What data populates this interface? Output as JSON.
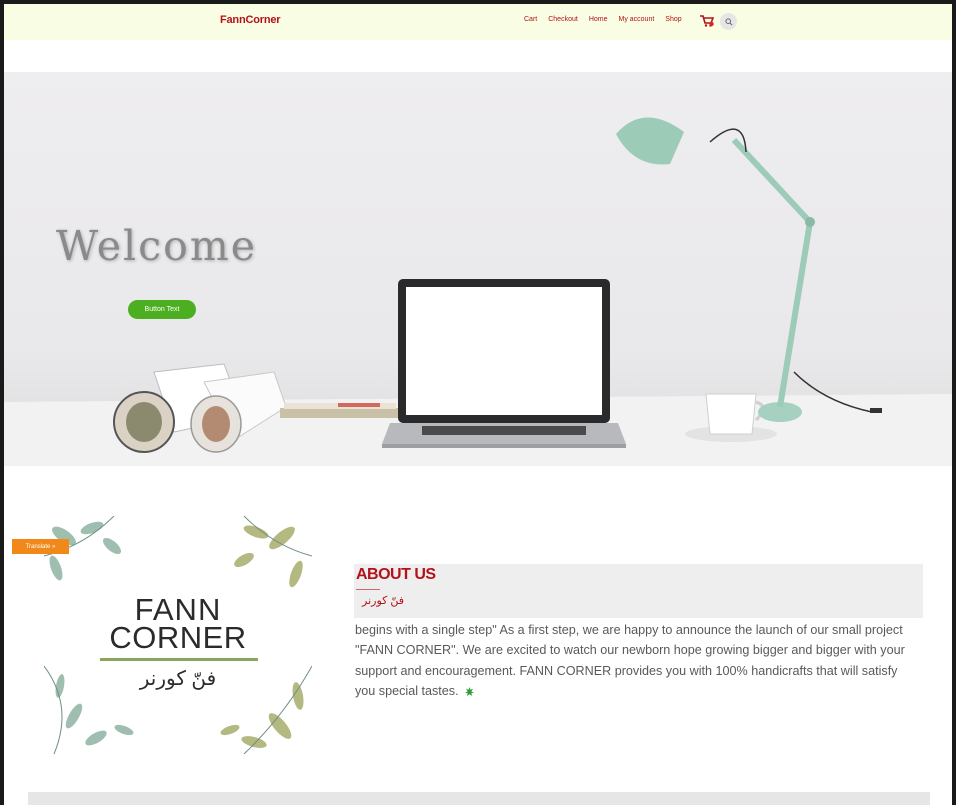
{
  "header": {
    "logo": "FannCorner",
    "nav": [
      "Cart",
      "Checkout",
      "Home",
      "My account",
      "Shop"
    ],
    "cart_icon": "cart-icon",
    "search_icon": "search-icon"
  },
  "hero": {
    "heading": "Welcome",
    "button_label": "Button Text"
  },
  "translate_label": "Translate »",
  "about": {
    "logo_line1": "FANN",
    "logo_line2": "CORNER",
    "logo_arabic": "فنّ كورنر",
    "title": "ABOUT US",
    "subtitle_arabic": "فنّ كورنر",
    "text": "begins with a single step\" As a first step, we are happy to announce the launch of our small project \"FANN CORNER\". We are excited to watch our newborn hope growing bigger and bigger with your support and encouragement. FANN CORNER provides you with 100% handicrafts that will satisfy you special tastes.",
    "leaf_icon": "leaf-icon"
  },
  "colors": {
    "brand_red": "#b3121a",
    "header_bg": "#f9fde3",
    "button_green": "#4caf22",
    "translate_orange": "#f0891a"
  }
}
